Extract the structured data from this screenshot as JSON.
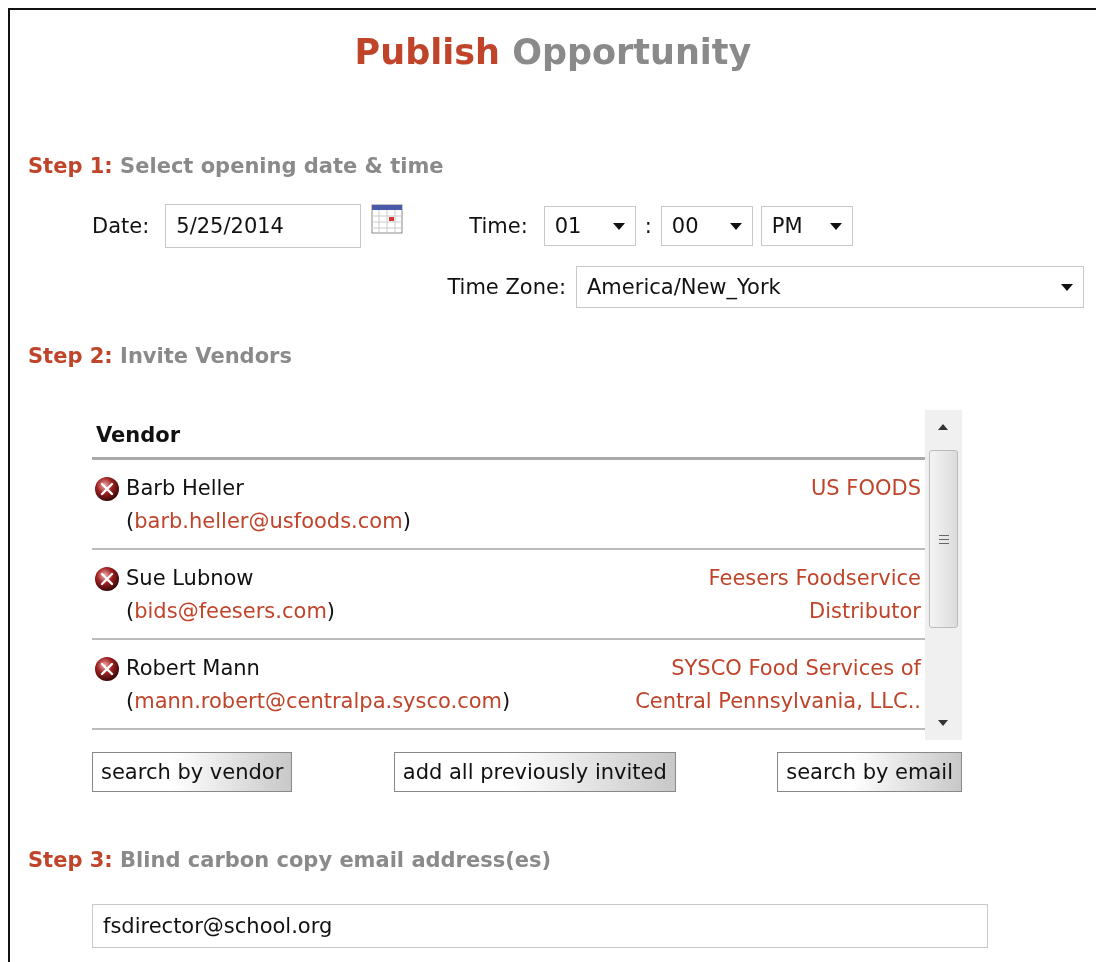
{
  "title": {
    "verb": "Publish",
    "noun": "Opportunity"
  },
  "step1": {
    "label": "Step 1:",
    "text": "Select opening date & time",
    "date": {
      "label": "Date:",
      "value": "5/25/2014"
    },
    "time": {
      "label": "Time:",
      "hour": "01",
      "separator": ":",
      "minute": "00",
      "period": "PM"
    },
    "time_zone": {
      "label": "Time Zone:",
      "value": "America/New_York"
    }
  },
  "step2": {
    "label": "Step 2:",
    "text": "Invite Vendors",
    "table": {
      "column": "Vendor",
      "rows": [
        {
          "name": "Barb Heller",
          "open": "(",
          "email": "barb.heller@usfoods.com",
          "close": ")",
          "company": "US FOODS"
        },
        {
          "name": "Sue Lubnow",
          "open": "(",
          "email": "bids@feesers.com",
          "close": ")",
          "company": "Feesers Foodservice Distributor"
        },
        {
          "name": "Robert Mann",
          "open": "(",
          "email": "mann.robert@centralpa.sysco.com",
          "close": ")",
          "company": "SYSCO Food Services of Central Pennsylvania, LLC.."
        }
      ]
    },
    "buttons": [
      "search by vendor",
      "add all previously invited",
      "search by email"
    ]
  },
  "step3": {
    "label": "Step 3:",
    "text": "Blind carbon copy email address(es)",
    "value": "fsdirector@school.org"
  }
}
